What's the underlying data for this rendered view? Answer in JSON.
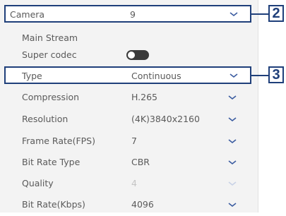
{
  "form": {
    "camera": {
      "label": "Camera",
      "value": "9"
    },
    "section_title": "Main Stream",
    "super_codec": {
      "label": "Super codec",
      "enabled": false
    },
    "type": {
      "label": "Type",
      "value": "Continuous"
    },
    "compression": {
      "label": "Compression",
      "value": "H.265"
    },
    "resolution": {
      "label": "Resolution",
      "value": "(4K)3840x2160"
    },
    "frame_rate": {
      "label": "Frame Rate(FPS)",
      "value": "7"
    },
    "bit_rate_type": {
      "label": "Bit Rate Type",
      "value": "CBR"
    },
    "quality": {
      "label": "Quality",
      "value": "4",
      "disabled": true
    },
    "bit_rate": {
      "label": "Bit Rate(Kbps)",
      "value": "4096"
    }
  },
  "callouts": {
    "camera": "2",
    "type": "3"
  },
  "colors": {
    "callout": "#1f3f7a",
    "chevron": "#3a5ba0",
    "toggle_off": "#3a3a3a"
  }
}
